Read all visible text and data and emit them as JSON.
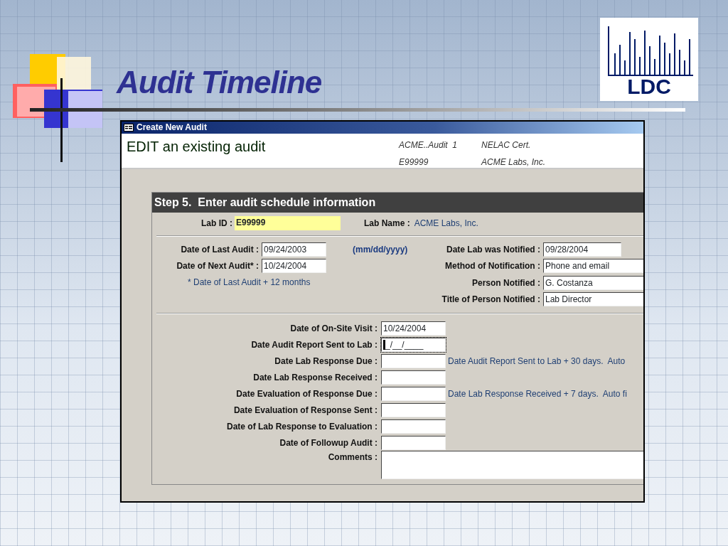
{
  "slide": {
    "title": "Audit Timeline",
    "logo_text": "LDC"
  },
  "window": {
    "title": "Create New Audit"
  },
  "header": {
    "heading": "EDIT an existing audit",
    "info": [
      "ACME..Audit  1",
      "NELAC Cert.",
      "E99999",
      "ACME Labs, Inc."
    ]
  },
  "section": {
    "title": "Step 5.  Enter audit schedule information"
  },
  "lab": {
    "id_label": "Lab ID :",
    "id_value": "E99999",
    "name_label": "Lab Name :",
    "name_value": "ACME Labs, Inc."
  },
  "audit_dates": [
    {
      "label": "Date of Last Audit :",
      "value": "09/24/2003"
    },
    {
      "label": "Date of Next Audit* :",
      "value": "10/24/2004"
    }
  ],
  "date_format_hint": "(mm/dd/yyyy)",
  "next_audit_note": "* Date of Last Audit + 12 months",
  "notification": [
    {
      "label": "Date Lab was Notified :",
      "value": "09/28/2004"
    },
    {
      "label": "Method of Notification :",
      "value": "Phone and email"
    },
    {
      "label": "Person Notified :",
      "value": "G. Costanza"
    },
    {
      "label": "Title of Person Notified :",
      "value": "Lab Director"
    }
  ],
  "schedule": [
    {
      "kind": "date",
      "label": "Date of On-Site Visit :",
      "value": "10/24/2004",
      "focused": false
    },
    {
      "kind": "date",
      "label": "Date Audit Report Sent to Lab :",
      "value": "_/__/____",
      "focused": true
    },
    {
      "kind": "date",
      "label": "Date Lab Response Due :",
      "note": "Date Audit Report Sent to Lab + 30 days.  Auto",
      "focused": false
    },
    {
      "kind": "date",
      "label": "Date Lab Response Received :",
      "focused": false
    },
    {
      "kind": "date",
      "label": "Date Evaluation of Response Due :",
      "note": "Date Lab Response Received + 7 days.  Auto fi",
      "focused": false
    },
    {
      "kind": "date",
      "label": "Date Evaluation of Response Sent :",
      "focused": false
    },
    {
      "kind": "date",
      "label": "Date of Lab Response to Evaluation :",
      "focused": false
    },
    {
      "kind": "date",
      "label": "Date of Followup Audit :",
      "focused": false
    },
    {
      "kind": "memo",
      "label": "Comments :",
      "focused": false
    }
  ]
}
